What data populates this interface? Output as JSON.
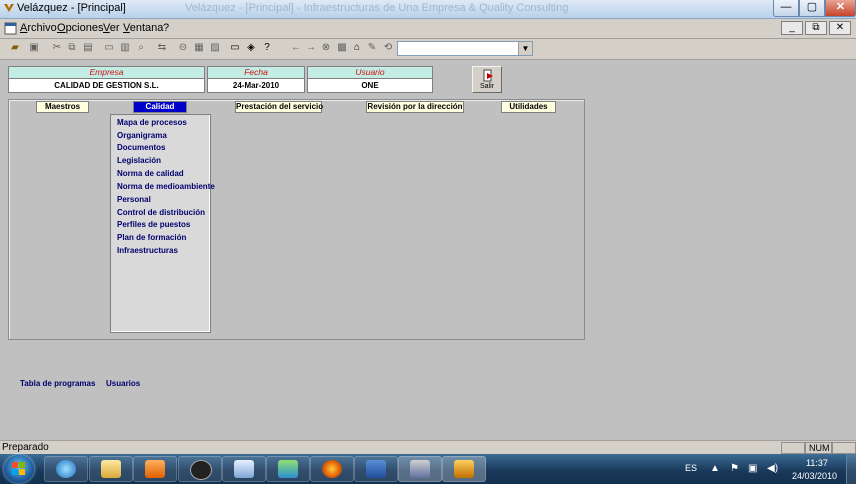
{
  "window": {
    "title": "Velázquez - [Principal]",
    "faded_title": "Velázquez - [Principal] - Infraestructuras de Una Empresa & Quality Consulting",
    "controls": {
      "minimize": "—",
      "maximize": "▢",
      "close": "✕"
    }
  },
  "menubar": {
    "items": [
      "Archivo",
      "Opciones",
      "Ver",
      "Ventana",
      "?"
    ],
    "mdi_controls": {
      "minimize": "_",
      "restore": "⧉",
      "close": "✕"
    }
  },
  "toolbar": {
    "icons": [
      "open-icon",
      "save-icon",
      "cut-icon",
      "copy-icon",
      "paste-icon",
      "print-icon",
      "preview-icon",
      "find-icon",
      "replace-icon",
      "link-icon",
      "calc-icon",
      "report-icon",
      "monitor-icon",
      "eraser-icon",
      "help-icon",
      "back-icon",
      "forward-icon",
      "stop-icon",
      "refresh-icon",
      "home-icon",
      "favorites-icon",
      "history-icon"
    ],
    "combo_value": ""
  },
  "info": {
    "empresa_label": "Empresa",
    "empresa_value": "CALIDAD DE GESTION S.L.",
    "fecha_label": "Fecha",
    "fecha_value": "24-Mar-2010",
    "usuario_label": "Usuario",
    "usuario_value": "ONE"
  },
  "salir_label": "Salir",
  "tabs": [
    {
      "label": "Maestros",
      "active": false
    },
    {
      "label": "Calidad",
      "active": true
    },
    {
      "label": "Prestación del servicio",
      "active": false
    },
    {
      "label": "Revisión por la dirección",
      "active": false
    },
    {
      "label": "Utilidades",
      "active": false
    }
  ],
  "submenu": [
    "Mapa de procesos",
    "Organigrama",
    "Documentos",
    "Legislación",
    "Norma de calidad",
    "Norma de medioambiente",
    "Personal",
    "Control de distribución",
    "Perfiles de puestos",
    "Plan de formación",
    "Infraestructuras"
  ],
  "bottom_links": [
    "Tabla de programas",
    "Usuarios"
  ],
  "statusbar": {
    "text": "Preparado",
    "num": "NUM"
  },
  "taskbar": {
    "lang": "ES",
    "time": "11:37",
    "date": "24/03/2010",
    "apps": [
      "internet-explorer",
      "file-explorer",
      "media-player",
      "hp-app",
      "chart-app",
      "messenger",
      "firefox",
      "word",
      "velazquez-editor",
      "velazquez"
    ]
  },
  "colors": {
    "active_tab": "#0000cc",
    "label_red": "#d01010",
    "link_navy": "#00006e",
    "label_bg": "#c2ece4",
    "tab_bg": "#ffffe0"
  }
}
